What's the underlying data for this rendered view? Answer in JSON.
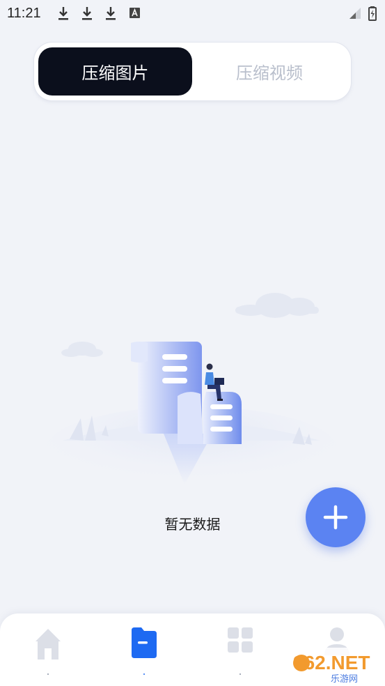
{
  "status_bar": {
    "time": "11:21",
    "notification_icons": [
      "download-icon",
      "download-icon",
      "download-icon",
      "text-a-icon"
    ],
    "right_icons": [
      "signal-icon",
      "battery-icon"
    ]
  },
  "tabs": [
    {
      "label": "压缩图片",
      "active": true
    },
    {
      "label": "压缩视频",
      "active": false
    }
  ],
  "empty_state": {
    "message": "暂无数据",
    "illustration": "empty-documents-illustration"
  },
  "fab": {
    "icon": "plus-icon",
    "color": "#5b83f2"
  },
  "bottom_nav": {
    "items": [
      {
        "icon": "home-icon",
        "active": false
      },
      {
        "icon": "folder-icon",
        "active": true
      },
      {
        "icon": "grid-icon",
        "active": false
      },
      {
        "icon": "user-icon",
        "active": false
      }
    ],
    "active_color": "#1e6af2",
    "inactive_color": "#dcdfe7"
  },
  "watermark": {
    "text": "962.NET",
    "subtext": "乐游网"
  }
}
